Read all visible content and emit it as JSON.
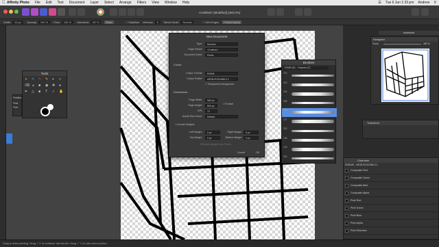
{
  "menubar": {
    "app_name": "Affinity Photo",
    "items": [
      "File",
      "Edit",
      "Text",
      "Document",
      "Layer",
      "Select",
      "Arrange",
      "Filters",
      "View",
      "Window",
      "Help"
    ],
    "datetime": "Tue 6 Jun 1:33 pm",
    "user": "Andrew"
  },
  "toolbar": {
    "doc_title": "<Untitled> [Modified] (483.0%)"
  },
  "context_toolbar": {
    "width_label": "Width:",
    "width_value": "54 px",
    "opacity_label": "Opacity:",
    "opacity_value": "100 %",
    "flow_label": "Flow:",
    "flow_value": "100 %",
    "hardness_label": "Hardness:",
    "hardness_value": "80 %",
    "more_label": "More",
    "stabiliser_label": "Stabiliser",
    "window_label": "Window:",
    "window_value": "5",
    "blend_label": "Blend Mode:",
    "blend_value": "Normal",
    "wet_edges_label": "Wet Edges",
    "protect_alpha_label": "Protect Alpha"
  },
  "tools_panel": {
    "title": "Tools"
  },
  "mini_panel": {
    "labels": [
      "Position",
      "Feat",
      "Fore"
    ]
  },
  "new_document": {
    "title": "New Document",
    "type_label": "Type:",
    "type_value": "Devices",
    "preset_label": "Page Preset:",
    "preset_value": "<Custom>",
    "units_label": "Document Units:",
    "units_value": "Pixels",
    "colour_heading": "Colour:",
    "colour_format_label": "Colour Format:",
    "colour_format_value": "RGB/8",
    "colour_profile_label": "Colour Profile:",
    "colour_profile_value": "sRGB IEC61966-2.1",
    "transparent_bg_label": "Transparent background",
    "dimensions_heading": "Dimensions:",
    "page_width_label": "Page Width:",
    "page_width_value": "960 px",
    "page_height_label": "Page Height:",
    "page_height_value": "600 px",
    "portrait_label": "Portrait",
    "dpi_label": "DPI:",
    "dpi_value": "72",
    "actual_zoom_label": "Actual Size Zoom:",
    "actual_zoom_value": "Default",
    "include_margins_label": "Include Margins",
    "left_margin_label": "Left Margin:",
    "left_margin_value": "0 px",
    "right_margin_label": "Right Margin:",
    "right_margin_value": "0 px",
    "top_margin_label": "Top Margin:",
    "top_margin_value": "0 px",
    "bottom_margin_label": "Bottom Margin:",
    "bottom_margin_value": "0 px",
    "retrieve_margins_label": "Retrieve Margin from Printer",
    "cancel_label": "Cancel",
    "ok_label": "OK"
  },
  "brushes_panel": {
    "title": "Brushes",
    "category": "DAUB (D) - Crayons (C)",
    "sizes": [
      "276",
      "200",
      "244",
      "266",
      "106",
      "127",
      "233",
      "136",
      "133",
      "200"
    ]
  },
  "assistant_tab": "Assistant",
  "navigator": {
    "title": "Navigator",
    "zoom_label": "Zoom",
    "zoom_value": "483 %"
  },
  "transform_panel": {
    "title": "Transform"
  },
  "channels_panel": {
    "title": "Channels",
    "profile": "RGBA/8 - sRGB IEC61966-2.1",
    "items": [
      "Composite Red",
      "Composite Green",
      "Composite Blue",
      "Composite Alpha",
      "Pixel Red",
      "Pixel Green",
      "Pixel Blue",
      "Pixel Alpha",
      "Pixel Selection"
    ]
  },
  "status": {
    "text": "Drag to start painting. Drag + ⇧ to continue last stroke. Drag + ⌥ to use colour picker."
  },
  "colors": {
    "accent": "#3d7bd6",
    "canvas": "#434343",
    "dialog": "#3a3a3a"
  }
}
